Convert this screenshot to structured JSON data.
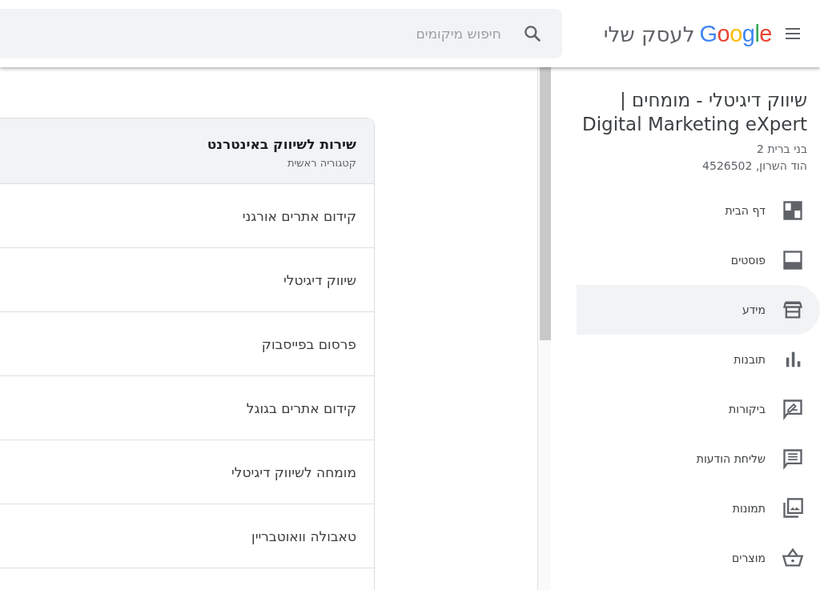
{
  "header": {
    "logo_brand": "Google",
    "logo_text": "לעסק שלי",
    "search": {
      "placeholder": "חיפוש מיקומים"
    }
  },
  "sidebar": {
    "business_name": "שיווק דיגיטלי - מומחים | Digital Marketing eXpert",
    "address_lines": [
      "בני ברית 2",
      "הוד השרון, 4526502"
    ],
    "items": [
      {
        "label": "דף הבית",
        "selected": false
      },
      {
        "label": "פוסטים",
        "selected": false
      },
      {
        "label": "מידע",
        "selected": true
      },
      {
        "label": "תובנות",
        "selected": false
      },
      {
        "label": "ביקורות",
        "selected": false
      },
      {
        "label": "שליחת הודעות",
        "selected": false
      },
      {
        "label": "תמונות",
        "selected": false
      },
      {
        "label": "מוצרים",
        "selected": false
      }
    ]
  },
  "category_card": {
    "title": "שירות לשיווק באינטרנט",
    "subtitle": "קטגוריה ראשית",
    "items": [
      "קידום אתרים אורגני",
      "שיווק דיגיטלי",
      "פרסום בפייסבוק",
      "קידום אתרים בגוגל",
      "מומחה לשיווק דיגיטלי",
      "טאבולה וואוטבריין"
    ]
  }
}
